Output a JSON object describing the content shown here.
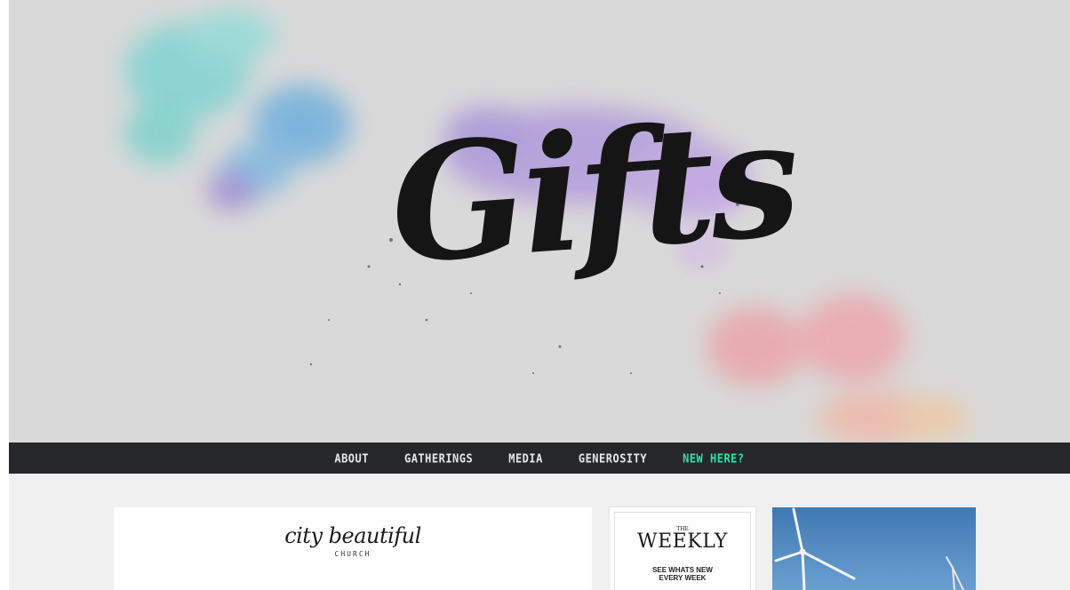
{
  "hero": {
    "title": "Gifts"
  },
  "nav": {
    "items": [
      {
        "label": "ABOUT"
      },
      {
        "label": "GATHERINGS"
      },
      {
        "label": "MEDIA"
      },
      {
        "label": "GENEROSITY"
      },
      {
        "label": "NEW HERE?"
      }
    ],
    "accent_color": "#2ee6a5"
  },
  "logo": {
    "script": "city beautiful",
    "sub": "CHURCH"
  },
  "weekly": {
    "the": "THE",
    "title": "WEEKLY",
    "subtitle_line1": "SEE WHATS NEW",
    "subtitle_line2": "EVERY WEEK"
  },
  "photo": {
    "icon": "wind-turbine-photo"
  }
}
